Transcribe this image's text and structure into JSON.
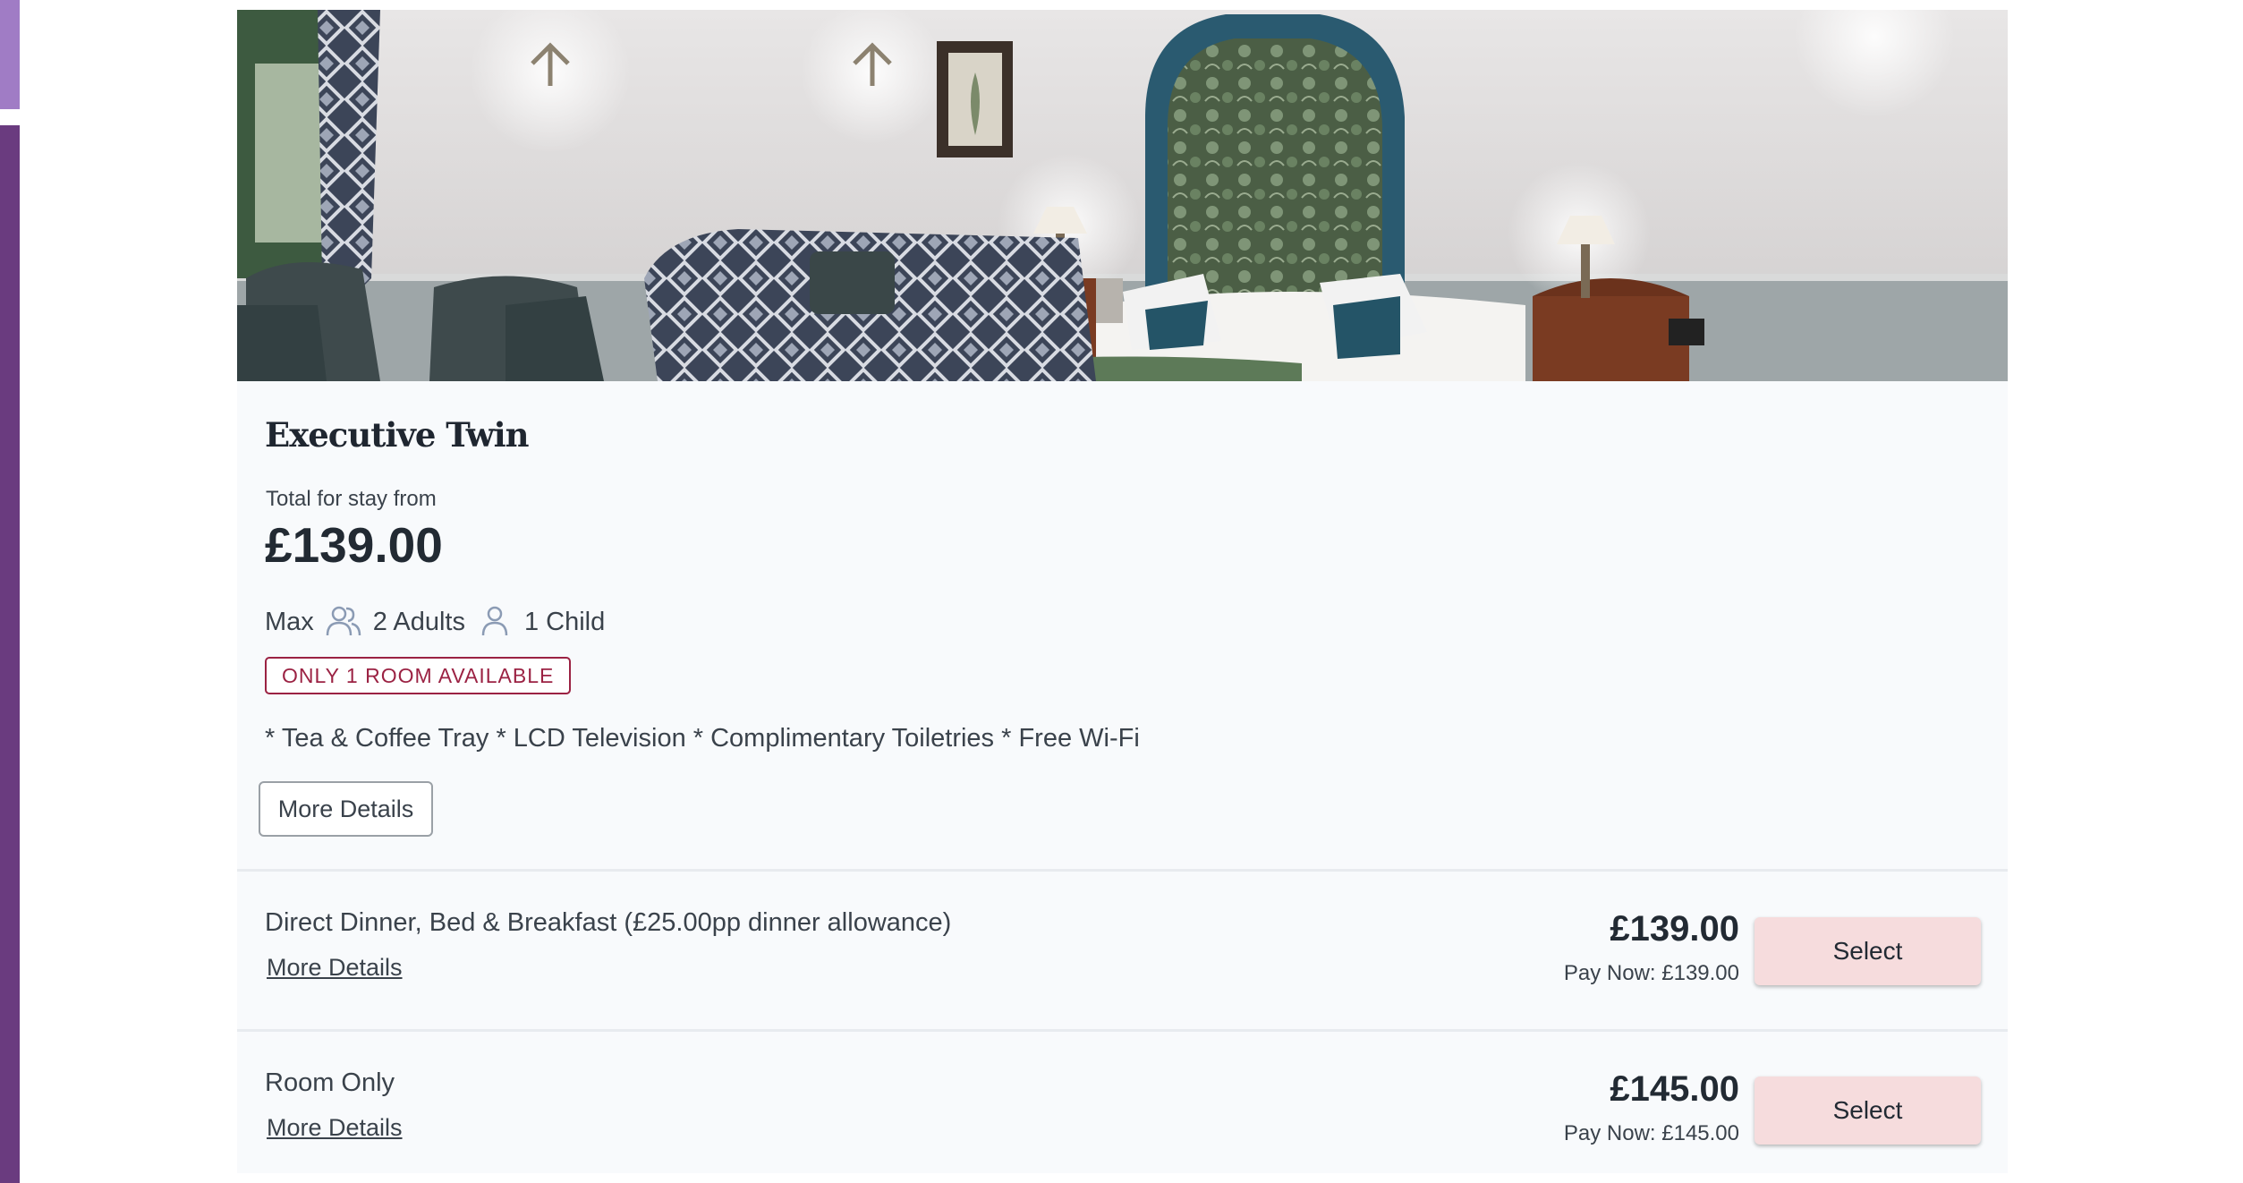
{
  "room": {
    "title": "Executive Twin",
    "total_label": "Total for stay from",
    "total_price": "£139.00",
    "occupancy": {
      "max_label": "Max",
      "adults": "2 Adults",
      "child": "1 Child"
    },
    "availability": "ONLY 1 ROOM AVAILABLE",
    "amenities": "* Tea & Coffee Tray * LCD Television * Complimentary Toiletries * Free Wi-Fi",
    "more_details_button": "More Details"
  },
  "rates": [
    {
      "name": "Direct Dinner, Bed & Breakfast (£25.00pp dinner allowance)",
      "link": "More Details",
      "price": "£139.00",
      "pay_now": "Pay Now: £139.00",
      "select_label": "Select"
    },
    {
      "name": "Room Only",
      "link": "More Details",
      "price": "£145.00",
      "pay_now": "Pay Now: £145.00",
      "select_label": "Select"
    }
  ],
  "colors": {
    "accent_light": "#a07cc5",
    "accent_dark": "#6a3b7f",
    "badge": "#9b2243",
    "select_button": "#f6dcdd",
    "card_background": "#f8fafc"
  },
  "icons": [
    "adults-icon",
    "child-icon"
  ]
}
